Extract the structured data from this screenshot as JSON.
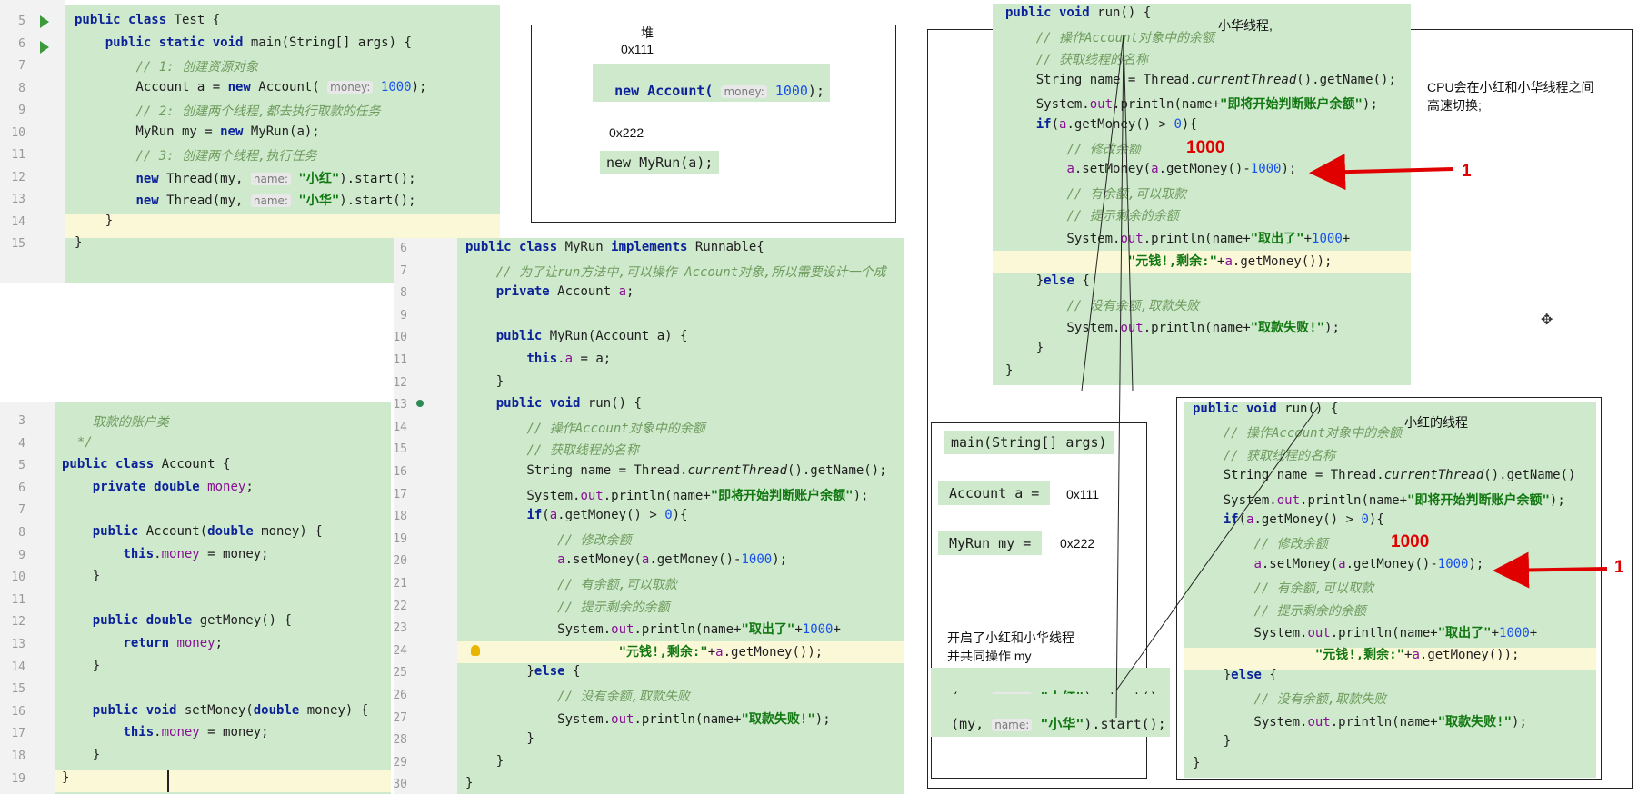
{
  "test_editor": {
    "line_numbers": [
      "5",
      "6",
      "7",
      "8",
      "9",
      "10",
      "11",
      "12",
      "13",
      "14",
      "15"
    ],
    "lines": [
      [
        {
          "t": "public class ",
          "c": "kw"
        },
        {
          "t": "Test {"
        }
      ],
      [
        {
          "t": "    "
        },
        {
          "t": "public static void ",
          "c": "kw"
        },
        {
          "t": "main(String[] args) {"
        }
      ],
      [
        {
          "t": "        "
        },
        {
          "t": "// 1: 创建资源对象",
          "c": "cm"
        }
      ],
      [
        {
          "t": "        Account a = "
        },
        {
          "t": "new ",
          "c": "kw"
        },
        {
          "t": "Account( "
        },
        {
          "t": "money:",
          "c": "hint"
        },
        {
          "t": " "
        },
        {
          "t": "1000",
          "c": "num"
        },
        {
          "t": ");"
        }
      ],
      [
        {
          "t": "        "
        },
        {
          "t": "// 2: 创建两个线程,都去执行取款的任务",
          "c": "cm"
        }
      ],
      [
        {
          "t": "        MyRun my = "
        },
        {
          "t": "new ",
          "c": "kw"
        },
        {
          "t": "MyRun(a);"
        }
      ],
      [
        {
          "t": "        "
        },
        {
          "t": "// 3: 创建两个线程,执行任务",
          "c": "cm"
        }
      ],
      [
        {
          "t": "        "
        },
        {
          "t": "new ",
          "c": "kw"
        },
        {
          "t": "Thread(my, "
        },
        {
          "t": "name:",
          "c": "hint"
        },
        {
          "t": " "
        },
        {
          "t": "\"小红\"",
          "c": "str"
        },
        {
          "t": ").start();"
        }
      ],
      [
        {
          "t": "        "
        },
        {
          "t": "new ",
          "c": "kw"
        },
        {
          "t": "Thread(my, "
        },
        {
          "t": "name:",
          "c": "hint"
        },
        {
          "t": " "
        },
        {
          "t": "\"小华\"",
          "c": "str"
        },
        {
          "t": ").start();"
        }
      ],
      [
        {
          "t": "    }"
        }
      ],
      [
        {
          "t": "}"
        }
      ]
    ]
  },
  "heap_diagram": {
    "title": "堆",
    "addr1": "0x111",
    "new_account_prefix": "new Account( ",
    "new_account_hint": "money:",
    "new_account_value": "1000",
    "new_account_suffix": ");",
    "addr2": "0x222",
    "new_myrun": "new MyRun(a);"
  },
  "account_editor": {
    "line_numbers": [
      "3",
      "4",
      "5",
      "6",
      "7",
      "8",
      "9",
      "10",
      "11",
      "12",
      "13",
      "14",
      "15",
      "16",
      "17",
      "18",
      "19"
    ],
    "lines": [
      [
        {
          "t": "    "
        },
        {
          "t": "取款的账户类",
          "c": "cm"
        }
      ],
      [
        {
          "t": "  "
        },
        {
          "t": "*/",
          "c": "cm"
        }
      ],
      [
        {
          "t": "public class ",
          "c": "kw"
        },
        {
          "t": "Account {"
        }
      ],
      [
        {
          "t": "    "
        },
        {
          "t": "private double ",
          "c": "kw"
        },
        {
          "t": "money",
          "c": "fld"
        },
        {
          "t": ";"
        }
      ],
      [
        {
          "t": ""
        }
      ],
      [
        {
          "t": "    "
        },
        {
          "t": "public ",
          "c": "kw"
        },
        {
          "t": "Account("
        },
        {
          "t": "double ",
          "c": "kw"
        },
        {
          "t": "money) {"
        }
      ],
      [
        {
          "t": "        "
        },
        {
          "t": "this",
          "c": "kw"
        },
        {
          "t": "."
        },
        {
          "t": "money",
          "c": "fld"
        },
        {
          "t": " = money;"
        }
      ],
      [
        {
          "t": "    }"
        }
      ],
      [
        {
          "t": ""
        }
      ],
      [
        {
          "t": "    "
        },
        {
          "t": "public double ",
          "c": "kw"
        },
        {
          "t": "getMoney() {"
        }
      ],
      [
        {
          "t": "        "
        },
        {
          "t": "return ",
          "c": "kw"
        },
        {
          "t": "money",
          "c": "fld"
        },
        {
          "t": ";"
        }
      ],
      [
        {
          "t": "    }"
        }
      ],
      [
        {
          "t": ""
        }
      ],
      [
        {
          "t": "    "
        },
        {
          "t": "public void ",
          "c": "kw"
        },
        {
          "t": "setMoney("
        },
        {
          "t": "double ",
          "c": "kw"
        },
        {
          "t": "money) {"
        }
      ],
      [
        {
          "t": "        "
        },
        {
          "t": "this",
          "c": "kw"
        },
        {
          "t": "."
        },
        {
          "t": "money",
          "c": "fld"
        },
        {
          "t": " = money;"
        }
      ],
      [
        {
          "t": "    }"
        }
      ],
      [
        {
          "t": "}"
        }
      ]
    ]
  },
  "myrun_editor": {
    "line_numbers": [
      "6",
      "7",
      "8",
      "9",
      "10",
      "11",
      "12",
      "13",
      "14",
      "15",
      "16",
      "17",
      "18",
      "19",
      "20",
      "21",
      "22",
      "23",
      "24",
      "25",
      "26",
      "27",
      "28",
      "29",
      "30"
    ],
    "lines": [
      [
        {
          "t": "public class ",
          "c": "kw"
        },
        {
          "t": "MyRun "
        },
        {
          "t": "implements ",
          "c": "kw"
        },
        {
          "t": "Runnable{"
        }
      ],
      [
        {
          "t": "    "
        },
        {
          "t": "// 为了让run方法中,可以操作 Account对象,所以需要设计一个成",
          "c": "cm"
        }
      ],
      [
        {
          "t": "    "
        },
        {
          "t": "private ",
          "c": "kw"
        },
        {
          "t": "Account "
        },
        {
          "t": "a",
          "c": "fld"
        },
        {
          "t": ";"
        }
      ],
      [
        {
          "t": ""
        }
      ],
      [
        {
          "t": "    "
        },
        {
          "t": "public ",
          "c": "kw"
        },
        {
          "t": "MyRun(Account a) {"
        }
      ],
      [
        {
          "t": "        "
        },
        {
          "t": "this",
          "c": "kw"
        },
        {
          "t": "."
        },
        {
          "t": "a",
          "c": "fld"
        },
        {
          "t": " = a;"
        }
      ],
      [
        {
          "t": "    }"
        }
      ],
      [
        {
          "t": "    "
        },
        {
          "t": "public void ",
          "c": "kw"
        },
        {
          "t": "run() {"
        }
      ],
      [
        {
          "t": "        "
        },
        {
          "t": "// 操作Account对象中的余额",
          "c": "cm"
        }
      ],
      [
        {
          "t": "        "
        },
        {
          "t": "// 获取线程的名称",
          "c": "cm"
        }
      ],
      [
        {
          "t": "        String name = Thread."
        },
        {
          "t": "currentThread",
          "c": "it"
        },
        {
          "t": "().getName();"
        }
      ],
      [
        {
          "t": "        System."
        },
        {
          "t": "out",
          "c": "fld"
        },
        {
          "t": ".println(name+"
        },
        {
          "t": "\"即将开始判断账户余额\"",
          "c": "str"
        },
        {
          "t": ");"
        }
      ],
      [
        {
          "t": "        "
        },
        {
          "t": "if",
          "c": "kw"
        },
        {
          "t": "("
        },
        {
          "t": "a",
          "c": "fld"
        },
        {
          "t": ".getMoney() > "
        },
        {
          "t": "0",
          "c": "num"
        },
        {
          "t": "){"
        }
      ],
      [
        {
          "t": "            "
        },
        {
          "t": "// 修改余额",
          "c": "cm"
        }
      ],
      [
        {
          "t": "            "
        },
        {
          "t": "a",
          "c": "fld"
        },
        {
          "t": ".setMoney("
        },
        {
          "t": "a",
          "c": "fld"
        },
        {
          "t": ".getMoney()-"
        },
        {
          "t": "1000",
          "c": "num"
        },
        {
          "t": ");"
        }
      ],
      [
        {
          "t": "            "
        },
        {
          "t": "// 有余额,可以取款",
          "c": "cm"
        }
      ],
      [
        {
          "t": "            "
        },
        {
          "t": "// 提示剩余的余额",
          "c": "cm"
        }
      ],
      [
        {
          "t": "            System."
        },
        {
          "t": "out",
          "c": "fld"
        },
        {
          "t": ".println(name+"
        },
        {
          "t": "\"取出了\"",
          "c": "str"
        },
        {
          "t": "+"
        },
        {
          "t": "1000",
          "c": "num"
        },
        {
          "t": "+"
        }
      ],
      [
        {
          "t": "                    "
        },
        {
          "t": "\"元钱!,剩余:\"",
          "c": "str"
        },
        {
          "t": "+"
        },
        {
          "t": "a",
          "c": "fld"
        },
        {
          "t": ".getMoney());"
        }
      ],
      [
        {
          "t": "        }"
        },
        {
          "t": "else ",
          "c": "kw"
        },
        {
          "t": "{"
        }
      ],
      [
        {
          "t": "            "
        },
        {
          "t": "// 没有余额,取款失败",
          "c": "cm"
        }
      ],
      [
        {
          "t": "            System."
        },
        {
          "t": "out",
          "c": "fld"
        },
        {
          "t": ".println(name+"
        },
        {
          "t": "\"取款失败!\"",
          "c": "str"
        },
        {
          "t": ");"
        }
      ],
      [
        {
          "t": "        }"
        }
      ],
      [
        {
          "t": "    }"
        }
      ],
      [
        {
          "t": "}"
        }
      ]
    ]
  },
  "xiaohua_run": {
    "label": "小华线程,",
    "amount": "1000",
    "arrow_num": "1",
    "lines": [
      [
        {
          "t": "public void ",
          "c": "kw"
        },
        {
          "t": "run() {"
        }
      ],
      [
        {
          "t": "    "
        },
        {
          "t": "// 操作Account对象中的余额",
          "c": "cm"
        }
      ],
      [
        {
          "t": "    "
        },
        {
          "t": "// 获取线程的名称",
          "c": "cm"
        }
      ],
      [
        {
          "t": "    String name = Thread."
        },
        {
          "t": "currentThread",
          "c": "it"
        },
        {
          "t": "().getName();"
        }
      ],
      [
        {
          "t": "    System."
        },
        {
          "t": "out",
          "c": "fld"
        },
        {
          "t": ".println(name+"
        },
        {
          "t": "\"即将开始判断账户余额\"",
          "c": "str"
        },
        {
          "t": ");"
        }
      ],
      [
        {
          "t": "    "
        },
        {
          "t": "if",
          "c": "kw"
        },
        {
          "t": "("
        },
        {
          "t": "a",
          "c": "fld"
        },
        {
          "t": ".getMoney() > "
        },
        {
          "t": "0",
          "c": "num"
        },
        {
          "t": "){"
        }
      ],
      [
        {
          "t": "        "
        },
        {
          "t": "// 修改余额",
          "c": "cm"
        }
      ],
      [
        {
          "t": "        "
        },
        {
          "t": "a",
          "c": "fld"
        },
        {
          "t": ".setMoney("
        },
        {
          "t": "a",
          "c": "fld"
        },
        {
          "t": ".getMoney()-"
        },
        {
          "t": "1000",
          "c": "num"
        },
        {
          "t": ");"
        }
      ],
      [
        {
          "t": "        "
        },
        {
          "t": "// 有余额,可以取款",
          "c": "cm"
        }
      ],
      [
        {
          "t": "        "
        },
        {
          "t": "// 提示剩余的余额",
          "c": "cm"
        }
      ],
      [
        {
          "t": "        System."
        },
        {
          "t": "out",
          "c": "fld"
        },
        {
          "t": ".println(name+"
        },
        {
          "t": "\"取出了\"",
          "c": "str"
        },
        {
          "t": "+"
        },
        {
          "t": "1000",
          "c": "num"
        },
        {
          "t": "+"
        }
      ],
      [
        {
          "t": "                "
        },
        {
          "t": "\"元钱!,剩余:\"",
          "c": "str"
        },
        {
          "t": "+"
        },
        {
          "t": "a",
          "c": "fld"
        },
        {
          "t": ".getMoney());"
        }
      ],
      [
        {
          "t": "    }"
        },
        {
          "t": "else ",
          "c": "kw"
        },
        {
          "t": "{"
        }
      ],
      [
        {
          "t": "        "
        },
        {
          "t": "// 没有余额,取款失败",
          "c": "cm"
        }
      ],
      [
        {
          "t": "        System."
        },
        {
          "t": "out",
          "c": "fld"
        },
        {
          "t": ".println(name+"
        },
        {
          "t": "\"取款失败!\"",
          "c": "str"
        },
        {
          "t": ");"
        }
      ],
      [
        {
          "t": "    }"
        }
      ],
      [
        {
          "t": "}"
        }
      ]
    ]
  },
  "cpu_note": "CPU会在小红和小华线程之间\n高速切换;",
  "stack_box": {
    "main_sig": "main(String[] args)",
    "account_var": "Account a =",
    "account_val": "0x111",
    "myrun_var": "MyRun my =",
    "myrun_val": "0x222",
    "note": "开启了小红和小华线程\n并共同操作 my",
    "thread1_prefix": "(my, ",
    "thread1_name": "\"小红\"",
    "thread1_suffix": ").start();",
    "thread2_prefix": "(my, ",
    "thread2_name": "\"小华\"",
    "thread2_suffix": ").start();",
    "hint_name": "name:"
  },
  "xiaohong_run": {
    "label": "小红的线程",
    "amount": "1000",
    "arrow_num": "1",
    "lines": [
      [
        {
          "t": "public void ",
          "c": "kw"
        },
        {
          "t": "run() {"
        }
      ],
      [
        {
          "t": "    "
        },
        {
          "t": "// 操作Account对象中的余额",
          "c": "cm"
        }
      ],
      [
        {
          "t": "    "
        },
        {
          "t": "// 获取线程的名称",
          "c": "cm"
        }
      ],
      [
        {
          "t": "    String name = Thread."
        },
        {
          "t": "currentThread",
          "c": "it"
        },
        {
          "t": "().getName()"
        }
      ],
      [
        {
          "t": "    System."
        },
        {
          "t": "out",
          "c": "fld"
        },
        {
          "t": ".println(name+"
        },
        {
          "t": "\"即将开始判断账户余额\"",
          "c": "str"
        },
        {
          "t": ");"
        }
      ],
      [
        {
          "t": "    "
        },
        {
          "t": "if",
          "c": "kw"
        },
        {
          "t": "("
        },
        {
          "t": "a",
          "c": "fld"
        },
        {
          "t": ".getMoney() > "
        },
        {
          "t": "0",
          "c": "num"
        },
        {
          "t": "){"
        }
      ],
      [
        {
          "t": "        "
        },
        {
          "t": "// 修改余额",
          "c": "cm"
        }
      ],
      [
        {
          "t": "        "
        },
        {
          "t": "a",
          "c": "fld"
        },
        {
          "t": ".setMoney("
        },
        {
          "t": "a",
          "c": "fld"
        },
        {
          "t": ".getMoney()-"
        },
        {
          "t": "1000",
          "c": "num"
        },
        {
          "t": ");"
        }
      ],
      [
        {
          "t": "        "
        },
        {
          "t": "// 有余额,可以取款",
          "c": "cm"
        }
      ],
      [
        {
          "t": "        "
        },
        {
          "t": "// 提示剩余的余额",
          "c": "cm"
        }
      ],
      [
        {
          "t": "        System."
        },
        {
          "t": "out",
          "c": "fld"
        },
        {
          "t": ".println(name+"
        },
        {
          "t": "\"取出了\"",
          "c": "str"
        },
        {
          "t": "+"
        },
        {
          "t": "1000",
          "c": "num"
        },
        {
          "t": "+"
        }
      ],
      [
        {
          "t": "                "
        },
        {
          "t": "\"元钱!,剩余:\"",
          "c": "str"
        },
        {
          "t": "+"
        },
        {
          "t": "a",
          "c": "fld"
        },
        {
          "t": ".getMoney());"
        }
      ],
      [
        {
          "t": "    }"
        },
        {
          "t": "else ",
          "c": "kw"
        },
        {
          "t": "{"
        }
      ],
      [
        {
          "t": "        "
        },
        {
          "t": "// 没有余额,取款失败",
          "c": "cm"
        }
      ],
      [
        {
          "t": "        System."
        },
        {
          "t": "out",
          "c": "fld"
        },
        {
          "t": ".println(name+"
        },
        {
          "t": "\"取款失败!\"",
          "c": "str"
        },
        {
          "t": ");"
        }
      ],
      [
        {
          "t": "    }"
        }
      ],
      [
        {
          "t": "}"
        }
      ]
    ]
  },
  "colors": {
    "editor_bg": "#cfe9cc",
    "highlight_line": "#fbf8d8",
    "keyword": "#0b2299",
    "string": "#117711",
    "comment": "#6e9c5e",
    "annotation_red": "#e00000"
  }
}
